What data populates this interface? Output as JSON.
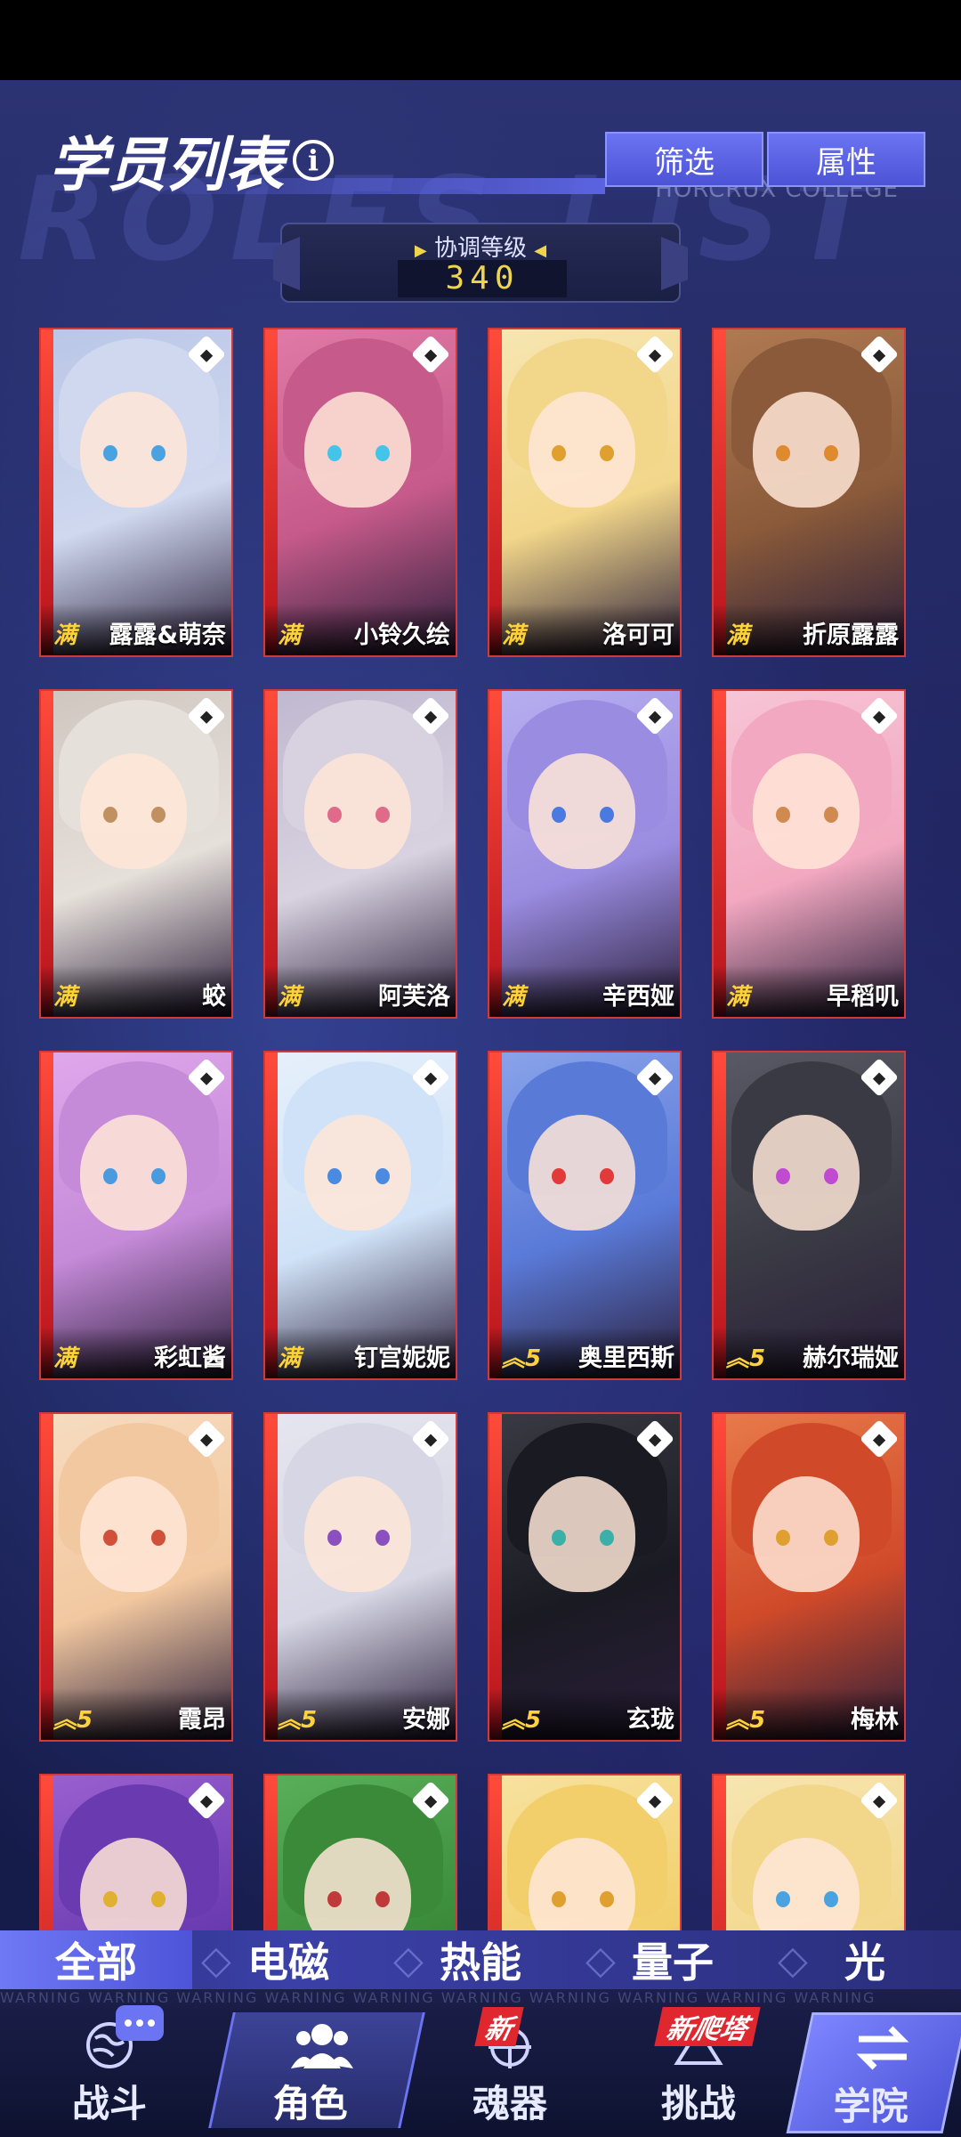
{
  "header": {
    "title": "学员列表",
    "watermark": "ROLES LIST",
    "college": "HORCRUX COLLEGE",
    "filter_label": "筛选",
    "attribute_label": "属性"
  },
  "sync": {
    "label": "协调等级",
    "value": "340"
  },
  "students": [
    {
      "name": "露露&萌奈",
      "rank": "满",
      "icon": "element-icon"
    },
    {
      "name": "小铃久绘",
      "rank": "满",
      "icon": "element-icon"
    },
    {
      "name": "洛可可",
      "rank": "满",
      "icon": "element-icon"
    },
    {
      "name": "折原露露",
      "rank": "满",
      "icon": "element-icon"
    },
    {
      "name": "蛟",
      "rank": "满",
      "icon": "element-icon"
    },
    {
      "name": "阿芙洛",
      "rank": "满",
      "icon": "element-icon"
    },
    {
      "name": "辛西娅",
      "rank": "满",
      "icon": "element-icon"
    },
    {
      "name": "早稻叽",
      "rank": "满",
      "icon": "element-icon"
    },
    {
      "name": "彩虹酱",
      "rank": "满",
      "icon": "element-icon"
    },
    {
      "name": "钉宫妮妮",
      "rank": "满",
      "icon": "element-icon"
    },
    {
      "name": "奥里西斯",
      "rank": "5",
      "icon": "element-icon"
    },
    {
      "name": "赫尔瑞娅",
      "rank": "5",
      "icon": "element-icon"
    },
    {
      "name": "霞昂",
      "rank": "5",
      "icon": "element-icon"
    },
    {
      "name": "安娜",
      "rank": "5",
      "icon": "element-icon"
    },
    {
      "name": "玄珑",
      "rank": "5",
      "icon": "element-icon"
    },
    {
      "name": "梅林",
      "rank": "5",
      "icon": "element-icon"
    },
    {
      "name": "",
      "rank": "",
      "icon": "element-icon"
    },
    {
      "name": "",
      "rank": "",
      "icon": "element-icon"
    },
    {
      "name": "",
      "rank": "",
      "icon": "element-icon"
    },
    {
      "name": "",
      "rank": "",
      "icon": "element-icon"
    }
  ],
  "filter_tabs": [
    {
      "label": "全部",
      "active": true
    },
    {
      "label": "电磁",
      "active": false
    },
    {
      "label": "热能",
      "active": false
    },
    {
      "label": "量子",
      "active": false
    },
    {
      "label": "光",
      "active": false
    }
  ],
  "nav": {
    "battle": "战斗",
    "role": "角色",
    "soul": "魂器",
    "soul_badge": "新",
    "challenge": "挑战",
    "challenge_badge": "新爬塔",
    "academy": "学院",
    "warning": "WARNING WARNING WARNING WARNING WARNING WARNING WARNING WARNING WARNING WARNING"
  },
  "colors": {
    "accent": "#5b63e0",
    "card_border": "#d23a3a",
    "rank_gold": "#ffd23a"
  }
}
